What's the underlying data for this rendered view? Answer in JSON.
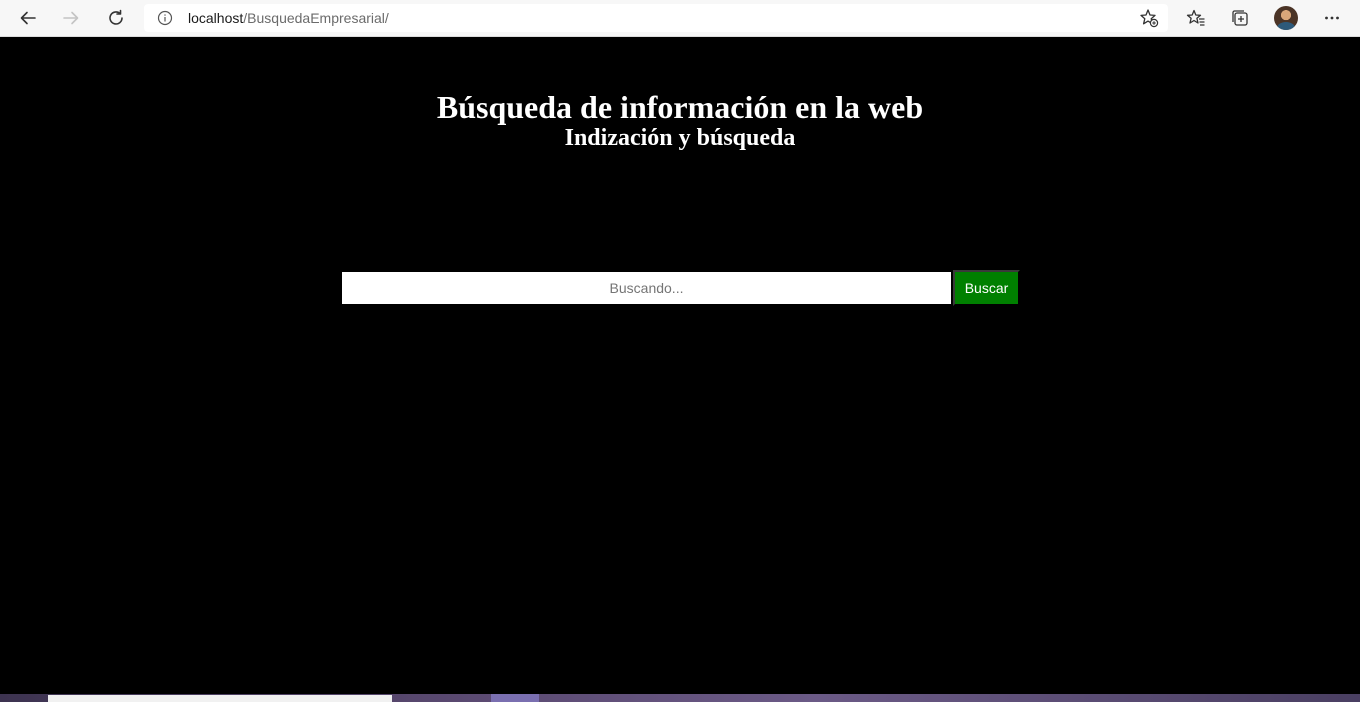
{
  "browser": {
    "url_host": "localhost",
    "url_path": "/BusquedaEmpresarial/",
    "icons": {
      "back": "back-arrow-icon",
      "forward": "forward-arrow-icon",
      "reload": "reload-icon",
      "site_info": "info-icon",
      "add_favorite": "add-favorite-icon",
      "favorites": "favorites-icon",
      "collections": "collections-icon",
      "profile": "avatar",
      "menu": "more-menu-icon"
    }
  },
  "page": {
    "title": "Búsqueda de información en la web",
    "subtitle": "Indización y búsqueda",
    "search": {
      "placeholder": "Buscando...",
      "value": "",
      "button_label": "Buscar"
    },
    "colors": {
      "background": "#000000",
      "text": "#ffffff",
      "button": "#008000"
    }
  }
}
